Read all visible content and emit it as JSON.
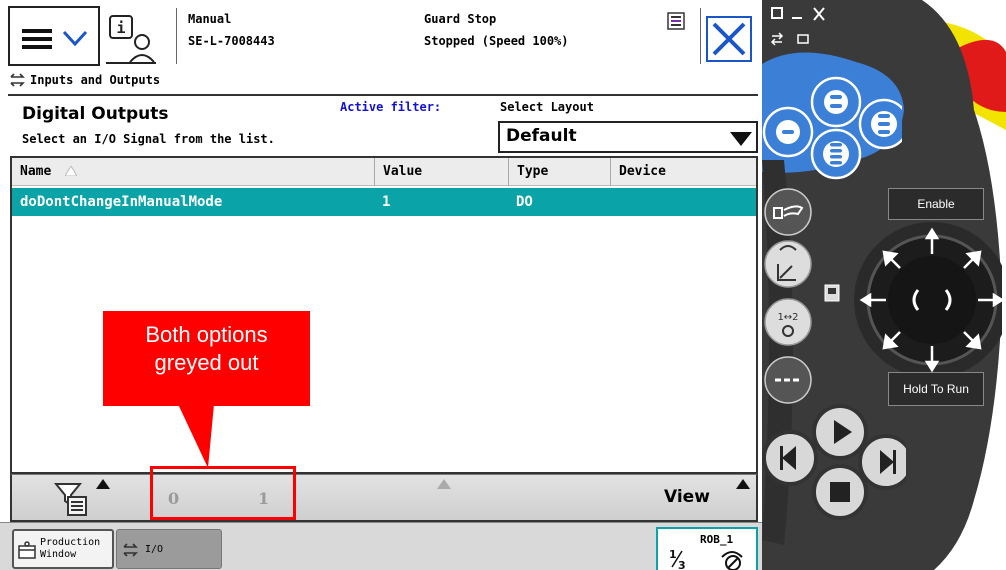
{
  "header": {
    "mode": "Manual",
    "controller": "SE-L-7008443",
    "state": "Guard Stop",
    "speed_status": "Stopped (Speed 100%)"
  },
  "window": {
    "title": "Inputs and Outputs"
  },
  "io_view": {
    "section_title": "Digital Outputs",
    "instruction": "Select an I/O Signal from the list.",
    "filter_label": "Active filter:",
    "layout_label": "Select Layout",
    "layout_value": "Default"
  },
  "table": {
    "columns": [
      "Name",
      "Value",
      "Type",
      "Device"
    ],
    "rows": [
      {
        "name": "doDontChangeInManualMode",
        "value": "1",
        "type": "DO",
        "device": ""
      }
    ]
  },
  "bottom_bar": {
    "option_0": "0",
    "option_1": "1",
    "view": "View"
  },
  "taskbar": {
    "production_window": "Production Window",
    "production_line1": "Production",
    "production_line2": "Window",
    "io": "I/O",
    "robot": "ROB_1",
    "fraction": "1/3"
  },
  "annotation": {
    "text": "Both options greyed out",
    "line1": "Both options",
    "line2": "greyed out",
    "color": "#ff0000"
  },
  "hardware": {
    "enable": "Enable",
    "hold_to_run": "Hold To Run"
  },
  "colors": {
    "selection": "#0aa3a8",
    "filter_text": "#1212d6",
    "close_button": "#1a56c7",
    "pendant_blue": "#3b7fd6",
    "pendant_yellow": "#f2e400",
    "emergency_red": "#e01919"
  },
  "icons": {
    "menu": "hamburger-icon",
    "status": "robot-status-icon",
    "event_log": "event-log-icon",
    "close": "close-icon",
    "io": "io-arrows-icon",
    "filter": "filter-icon",
    "production": "production-window-icon",
    "quickset_mechunit": "mechanical-unit-icon"
  }
}
